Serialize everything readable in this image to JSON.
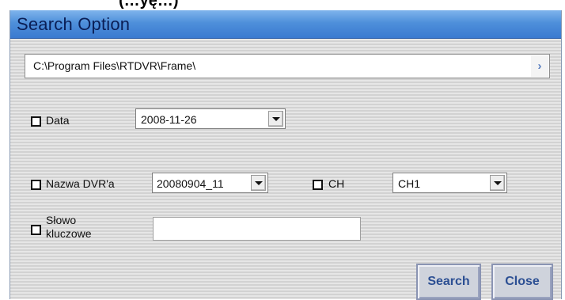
{
  "window": {
    "title": "Search Option"
  },
  "top_strip": {
    "text": "(…yę…)"
  },
  "path": {
    "value": "C:\\Program Files\\RTDVR\\Frame\\",
    "browse_glyph": "›"
  },
  "filters": {
    "data": {
      "label": "Data",
      "checked": false,
      "value": "2008-11-26"
    },
    "dvr": {
      "label": "Nazwa DVR'a",
      "checked": false,
      "value": "20080904_11"
    },
    "ch": {
      "label": "CH",
      "checked": false,
      "value": "CH1"
    },
    "keyword": {
      "label_line1": "Słowo",
      "label_line2": "kluczowe",
      "checked": false,
      "value": ""
    }
  },
  "buttons": {
    "search": "Search",
    "close": "Close"
  },
  "colors": {
    "title_bar": "#4e8fda",
    "button_text": "#2c4f93"
  }
}
